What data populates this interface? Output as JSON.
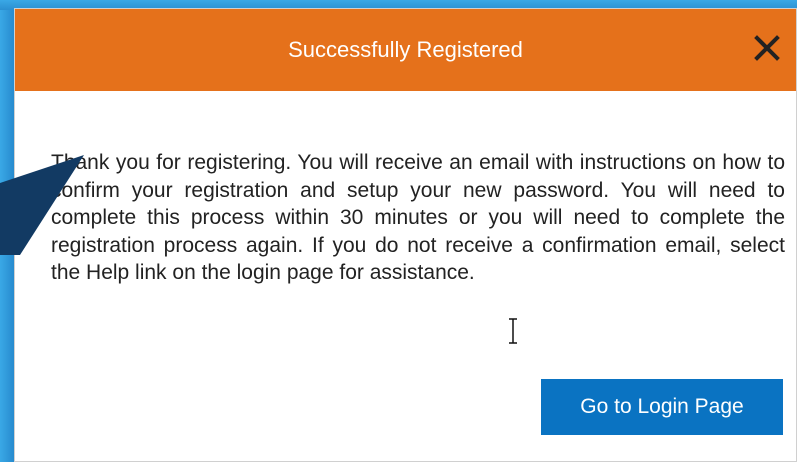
{
  "dialog": {
    "title": "Successfully Registered",
    "close_icon": "close-icon",
    "message": "Thank you for registering. You will receive an email with instructions on how to confirm your registration and setup your new password. You will need to complete this process within 30 minutes or you will need to complete the registration process again. If you do not receive a confirmation email, select the Help link on the login page for assistance.",
    "login_button_label": "Go to Login Page"
  },
  "colors": {
    "header": "#e5711b",
    "button": "#0a73c2",
    "background": "#2b8fd0",
    "arrow": "#123a63"
  }
}
